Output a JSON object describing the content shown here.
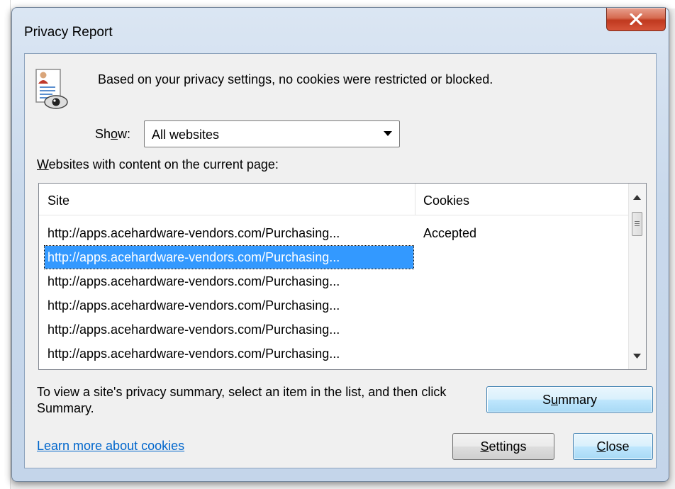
{
  "window": {
    "title": "Privacy Report"
  },
  "intro_text": "Based on your privacy settings, no cookies were restricted or blocked.",
  "show": {
    "label_pre": "Sh",
    "label_accel": "o",
    "label_post": "w:",
    "selected": "All websites"
  },
  "list_label": {
    "accel": "W",
    "rest": "ebsites with content on the current page:"
  },
  "table": {
    "columns": [
      "Site",
      "Cookies"
    ],
    "rows": [
      {
        "site": "http://apps.acehardware-vendors.com/Purchasing...",
        "cookies": "Accepted",
        "selected": false
      },
      {
        "site": "http://apps.acehardware-vendors.com/Purchasing...",
        "cookies": "",
        "selected": true
      },
      {
        "site": "http://apps.acehardware-vendors.com/Purchasing...",
        "cookies": "",
        "selected": false
      },
      {
        "site": "http://apps.acehardware-vendors.com/Purchasing...",
        "cookies": "",
        "selected": false
      },
      {
        "site": "http://apps.acehardware-vendors.com/Purchasing...",
        "cookies": "",
        "selected": false
      },
      {
        "site": "http://apps.acehardware-vendors.com/Purchasing...",
        "cookies": "",
        "selected": false
      }
    ]
  },
  "hint_text": "To view a site's privacy summary, select an item in the list, and then click Summary.",
  "buttons": {
    "summary": {
      "pre": "S",
      "accel": "u",
      "post": "mmary"
    },
    "settings": {
      "pre": "",
      "accel": "S",
      "post": "ettings"
    },
    "close": {
      "pre": "",
      "accel": "C",
      "post": "lose"
    }
  },
  "learn_more_link": "Learn more about cookies",
  "colors": {
    "selection": "#3399ff",
    "link": "#0066cc",
    "close_button": "#c0391e"
  }
}
